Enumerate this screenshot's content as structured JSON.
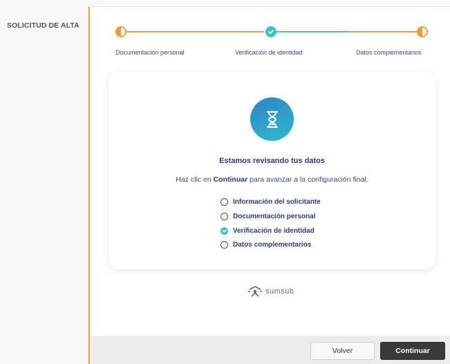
{
  "sidebar": {
    "title": "SOLICITUD DE ALTA"
  },
  "stepper": {
    "steps": [
      {
        "label": "Documentación personal",
        "state": "in-progress"
      },
      {
        "label": "Verificación de identidad",
        "state": "done"
      },
      {
        "label": "Datos complementarios",
        "state": "in-progress"
      }
    ]
  },
  "card": {
    "icon": "hourglass-icon",
    "title": "Estamos revisando tus datos",
    "subtitle_prefix": "Haz clic en",
    "subtitle_bold": "Continuar",
    "subtitle_suffix": "para avanzar a la configuración final.",
    "checklist": [
      {
        "label": "Información del solicitante",
        "done": false
      },
      {
        "label": "Documentación personal",
        "done": false
      },
      {
        "label": "Verificación de identidad",
        "done": true
      },
      {
        "label": "Datos complementarios",
        "done": false
      }
    ]
  },
  "brand": {
    "name": "sumsub"
  },
  "footer": {
    "back_label": "Volver",
    "continue_label": "Continuar"
  },
  "colors": {
    "accent_orange": "#f39a36",
    "accent_teal": "#3cc0c6",
    "text_navy": "#2b3980",
    "button_dark": "#3a3a3a"
  }
}
